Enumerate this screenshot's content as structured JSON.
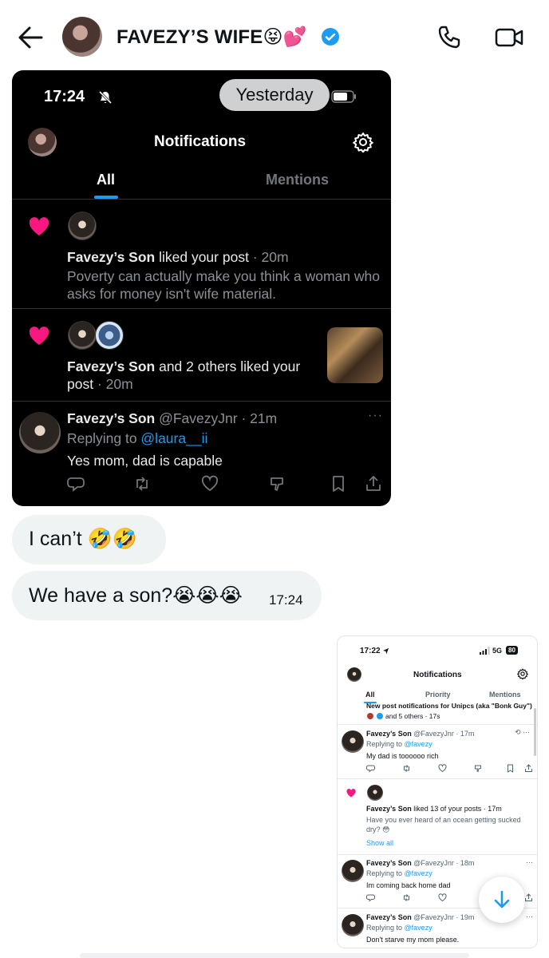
{
  "header": {
    "title": "FAVEZY’S WIFE😝💕",
    "verified": "verified-badge-icon"
  },
  "dark_screenshot": {
    "status_time": "17:24",
    "date_pill": "Yesterday",
    "title": "Notifications",
    "tabs": [
      "All",
      "Mentions"
    ],
    "notif1": {
      "name": "Favezy’s Son",
      "action": " liked your post",
      "time": " · 20m",
      "body": "Poverty can actually make you think a woman who asks for money isn't wife material."
    },
    "notif2": {
      "name": "Favezy’s Son",
      "action": " and 2 others liked your post",
      "time": " · 20m"
    },
    "reply": {
      "name": "Favezy’s Son",
      "handle": " @FavezyJnr · 21m",
      "replying_to_label": "Replying to ",
      "replying_to_handle": "@laura__ii",
      "body": "Yes mom, dad is capable"
    }
  },
  "messages": [
    {
      "text": "I can’t 🤣🤣"
    },
    {
      "text": "We have a son?😭😭😭",
      "time": "17:24"
    }
  ],
  "light_screenshot": {
    "status_time": "17:22",
    "network": "5G",
    "battery": "80",
    "title": "Notifications",
    "tabs": [
      "All",
      "Priority",
      "Mentions"
    ],
    "top_partial": "New post notifications for Unipcs (aka \"Bonk Guy\")",
    "top_others": "and 5 others · 17s",
    "items": [
      {
        "name": "Favezy’s Son",
        "handle": " @FavezyJnr · 17m",
        "replying": "Replying to ",
        "to": "@favezy",
        "body": "My dad is toooooo rich"
      },
      {
        "name": "Favezy’s Son",
        "action": " liked 13 of your posts · 17m",
        "body1": "Have you ever heard of an ocean getting sucked",
        "body2": "dry? 😳",
        "link": "Show all"
      },
      {
        "name": "Favezy’s Son",
        "handle": " @FavezyJnr · 18m",
        "replying": "Replying to ",
        "to": "@favezy",
        "body": "Im coming back home dad"
      },
      {
        "name": "Favezy’s Son",
        "handle": " @FavezyJnr · 19m",
        "replying": "Replying to ",
        "to": "@favezy",
        "body": "Don't starve my mom please."
      }
    ]
  },
  "colors": {
    "heart": "#f91880",
    "link": "#1d9bf0",
    "bubble": "#eff3f4"
  }
}
